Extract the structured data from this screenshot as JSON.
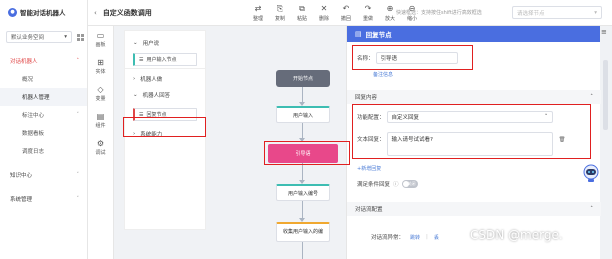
{
  "app": {
    "name": "智能对话机器人"
  },
  "bot_select": {
    "value": "默认业务空间"
  },
  "sidebar": {
    "items": [
      {
        "label": "对话机器人",
        "type": "parent",
        "active": true
      },
      {
        "label": "概况",
        "type": "sub"
      },
      {
        "label": "机器人管理",
        "type": "sub",
        "selected": true
      },
      {
        "label": "标注中心",
        "type": "sub"
      },
      {
        "label": "数据看板",
        "type": "sub"
      },
      {
        "label": "调度日志",
        "type": "sub"
      },
      {
        "label": "知识中心",
        "type": "parent"
      },
      {
        "label": "系统管理",
        "type": "parent"
      }
    ]
  },
  "header": {
    "back": "‹",
    "title": "自定义函数调用",
    "tools": [
      {
        "icon": "⇄",
        "label": "整理"
      },
      {
        "icon": "⎘",
        "label": "复制"
      },
      {
        "icon": "⧉",
        "label": "粘贴"
      },
      {
        "icon": "✕",
        "label": "删除"
      },
      {
        "icon": "↶",
        "label": "撤回"
      },
      {
        "icon": "↷",
        "label": "重做"
      },
      {
        "icon": "⊕",
        "label": "放大"
      },
      {
        "icon": "⊖",
        "label": "缩小"
      }
    ],
    "quick_tip": "快速框选：支持按住shift进行高效框选",
    "search_placeholder": "请选择节点"
  },
  "rail": [
    {
      "icon": "▭",
      "label": "画板"
    },
    {
      "icon": "⊞",
      "label": "实体"
    },
    {
      "icon": "◇",
      "label": "变量"
    },
    {
      "icon": "▤",
      "label": "组件"
    },
    {
      "icon": "⚙",
      "label": "调试"
    }
  ],
  "palette": {
    "group_user": "用户说",
    "node_user_input": "用户输入节点",
    "group_bot_act": "机器人做",
    "group_bot_reply": "机器人回答",
    "node_reply": "回复节点",
    "group_system": "系统能力"
  },
  "flow": {
    "start": "开始节点",
    "user_input": "用户输入",
    "reply": "引导语",
    "user_input_number": "用户输入编号",
    "collect": "收集用户输入的编"
  },
  "panel": {
    "title": "回复节点",
    "name_label": "名称：",
    "name_value": "引导语",
    "remark_link": "备注信息",
    "section_reply": "回复内容",
    "function_label": "功能配置：",
    "function_value": "自定义回复",
    "text_label": "文本回复：",
    "text_value": "输入请号试试看?",
    "add_reply": "+新增回复",
    "condition_label": "满足条件回复",
    "toggle_text": "关闭",
    "section_exception": "对话流配置",
    "exception_label": "对话流异常：",
    "exception_link1": "跳转",
    "exception_link2": "丢"
  },
  "watermark": "CSDN @merge."
}
